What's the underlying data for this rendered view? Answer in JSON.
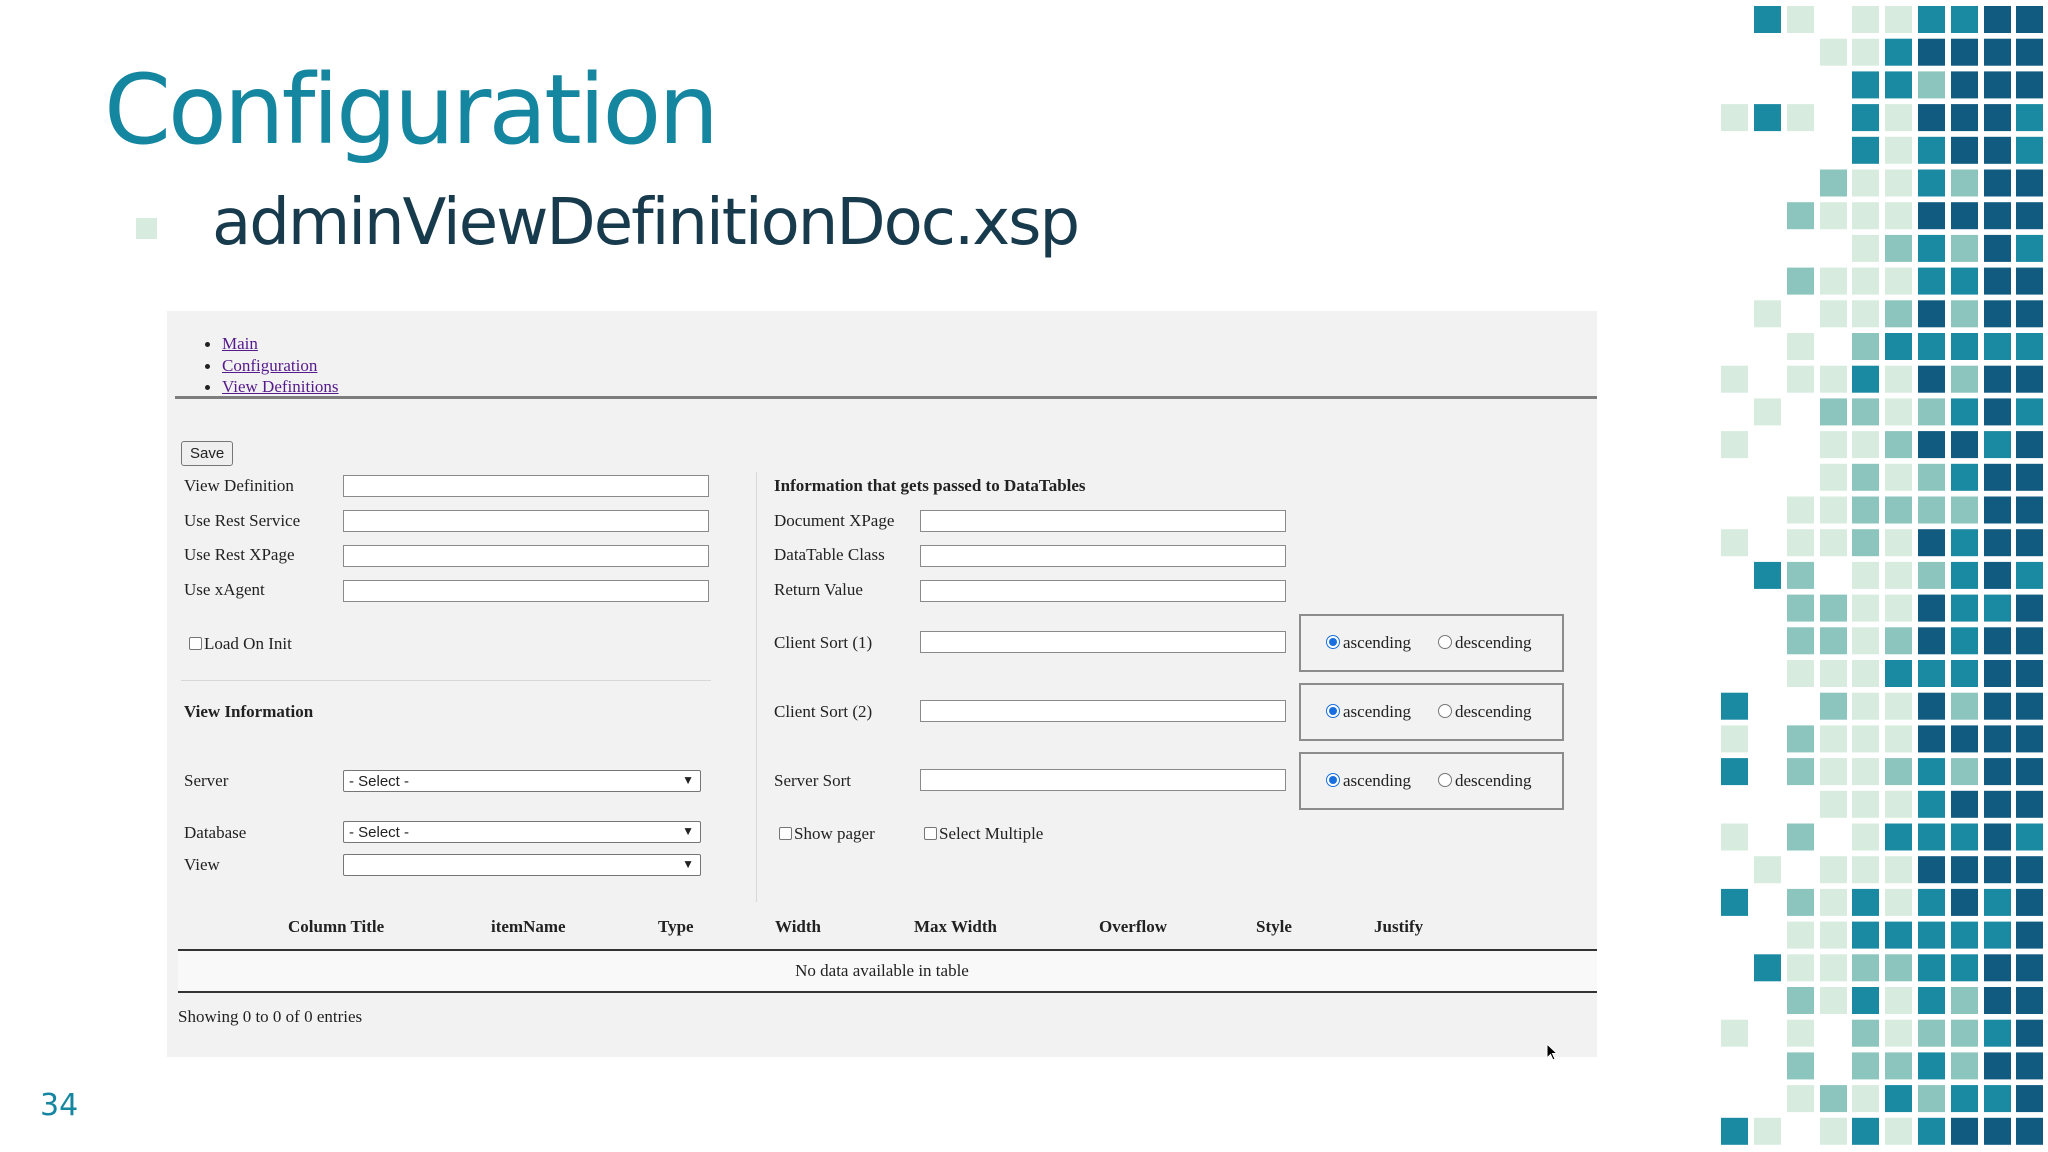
{
  "slide": {
    "title": "Configuration",
    "subtitle": "adminViewDefinitionDoc.xsp",
    "page_number": "34"
  },
  "colors": {
    "title": "#1586a0",
    "subtitle": "#173a4c",
    "deco_light": "#d7ecde",
    "deco_mid": "#8cc5bd",
    "deco_teal": "#1a8aa3",
    "deco_dark": "#115a80"
  },
  "nav": {
    "items": [
      "Main",
      "Configuration",
      "View Definitions"
    ]
  },
  "form": {
    "save_label": "Save",
    "left_fields": [
      "View Definition",
      "Use Rest Service",
      "Use Rest XPage",
      "Use xAgent"
    ],
    "load_on_init": "Load On Init",
    "view_info_heading": "View Information",
    "server_label": "Server",
    "server_value": "- Select -",
    "database_label": "Database",
    "database_value": "- Select -",
    "view_label": "View",
    "view_value": "",
    "right_heading": "Information that gets passed to DataTables",
    "right_fields": [
      "Document XPage",
      "DataTable Class",
      "Return Value"
    ],
    "sorts": [
      {
        "label": "Client Sort (1)",
        "selected": "ascending"
      },
      {
        "label": "Client Sort (2)",
        "selected": "ascending"
      },
      {
        "label": "Server Sort",
        "selected": "ascending"
      }
    ],
    "ascending": "ascending",
    "descending": "descending",
    "show_pager": "Show pager",
    "select_multiple": "Select Multiple"
  },
  "table": {
    "columns": [
      "Column Title",
      "itemName",
      "Type",
      "Width",
      "Max Width",
      "Overflow",
      "Style",
      "Justify"
    ],
    "empty_message": "No data available in table",
    "info": "Showing 0 to 0 of 0 entries"
  }
}
